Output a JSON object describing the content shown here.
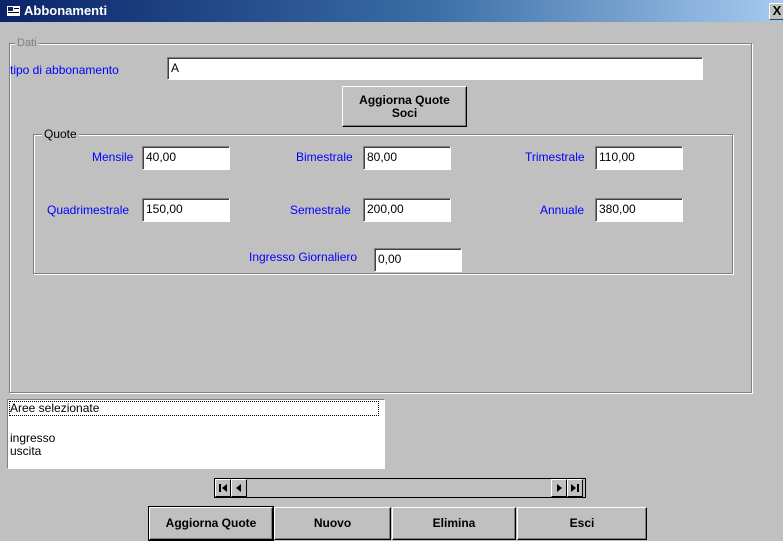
{
  "window": {
    "title": "Abbonamenti",
    "close_label": "X"
  },
  "dati": {
    "legend": "Dati",
    "tipo_label": "tipo di abbonamento",
    "tipo_value": "A",
    "aggiorna_soci_label": "Aggiorna Quote Soci"
  },
  "quote": {
    "legend": "Quote",
    "mensile": {
      "label": "Mensile",
      "value": "40,00"
    },
    "bimestrale": {
      "label": "Bimestrale",
      "value": "80,00"
    },
    "trimestrale": {
      "label": "Trimestrale",
      "value": "110,00"
    },
    "quadrimestrale": {
      "label": "Quadrimestrale",
      "value": "150,00"
    },
    "semestrale": {
      "label": "Semestrale",
      "value": "200,00"
    },
    "annuale": {
      "label": "Annuale",
      "value": "380,00"
    },
    "ingresso": {
      "label": "Ingresso Giornaliero",
      "value": "0,00"
    }
  },
  "aree": {
    "header": "Aree selezionate",
    "items": [
      "ingresso",
      "uscita"
    ]
  },
  "navigator": {
    "icons": [
      "first-record-icon",
      "prev-record-icon",
      "next-record-icon",
      "last-record-icon"
    ]
  },
  "buttons": {
    "aggiorna_quote": "Aggiorna Quote",
    "nuovo": "Nuovo",
    "elimina": "Elimina",
    "esci": "Esci"
  },
  "colors": {
    "title_bar": "#0a246a",
    "label_blue": "#0000ff",
    "face": "#c0c0c0"
  }
}
